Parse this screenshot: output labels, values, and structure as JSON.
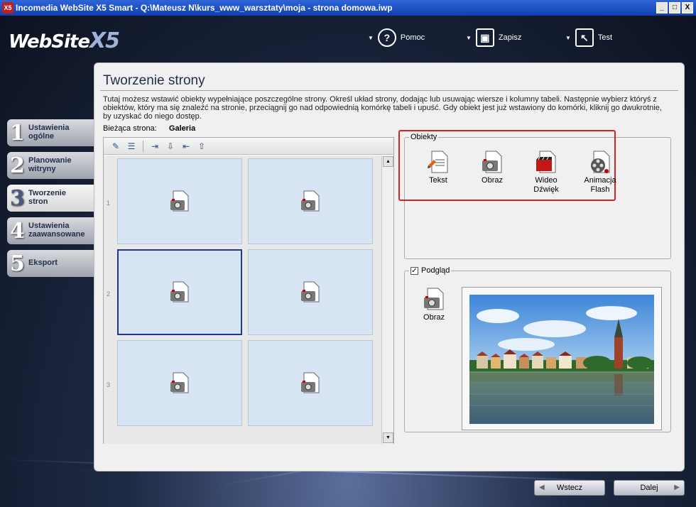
{
  "window": {
    "title": "Incomedia WebSite X5 Smart - Q:\\Mateusz N\\kurs_www_warsztaty\\moja - strona domowa.iwp",
    "app_icon": "X5",
    "buttons": [
      "_",
      "□",
      "X"
    ]
  },
  "logo": {
    "main": "WebSite",
    "suffix": "X5"
  },
  "topbar": {
    "help": "Pomoc",
    "save": "Zapisz",
    "test": "Test"
  },
  "steps": [
    {
      "num": "1",
      "label": "Ustawienia ogólne"
    },
    {
      "num": "2",
      "label": "Planowanie witryny"
    },
    {
      "num": "3",
      "label": "Tworzenie stron"
    },
    {
      "num": "4",
      "label": "Ustawienia zaawansowane"
    },
    {
      "num": "5",
      "label": "Eksport"
    }
  ],
  "active_step": 3,
  "page": {
    "title": "Tworzenie strony",
    "description": "Tutaj możesz wstawić obiekty wypełniające poszczególne strony. Określ układ strony, dodając lub usuwając wiersze i kolumny tabeli. Następnie wybierz któryś z obiektów, który ma się znaleźć na stronie, przeciągnij go nad odpowiednią komórkę tabeli i upuść. Gdy obiekt jest już wstawiony do komórki, kliknij go dwukrotnie, by uzyskać do niego dostęp.",
    "current_label": "Bieżąca strona:",
    "current_value": "Galeria"
  },
  "grid": {
    "row_numbers": [
      "1",
      "2",
      "3"
    ],
    "cell_icon": "image-object-icon"
  },
  "objects": {
    "legend": "Obiekty",
    "items": [
      {
        "label": "Tekst",
        "icon": "text-object-icon"
      },
      {
        "label": "Obraz",
        "icon": "image-object-icon"
      },
      {
        "label": "Wideo Dźwięk",
        "icon": "video-object-icon"
      },
      {
        "label": "Animacja Flash",
        "icon": "flash-object-icon"
      }
    ]
  },
  "preview": {
    "legend": "Podgląd",
    "checked": true,
    "object_label": "Obraz"
  },
  "nav": {
    "back": "Wstecz",
    "next": "Dalej"
  },
  "colors": {
    "accent_red": "#d82020",
    "cell_bg": "#d6e4f4",
    "title_blue": "#1f2d4c"
  }
}
